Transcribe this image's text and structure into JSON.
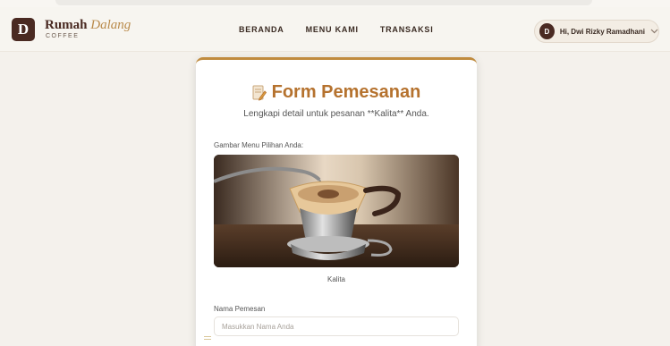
{
  "brand": {
    "logo_letter": "D",
    "name_bold": "Rumah",
    "name_italic": "Dalang",
    "sub": "COFFEE"
  },
  "nav": {
    "links": [
      "BERANDA",
      "MENU KAMI",
      "TRANSAKSI"
    ]
  },
  "user": {
    "avatar_letter": "D",
    "greeting": "Hi, Dwi Rizky Ramadhani"
  },
  "form": {
    "title": "Form Pemesanan",
    "subtitle": "Lengkapi detail untuk pesanan **Kalita** Anda.",
    "image_label": "Gambar Menu Pilihan Anda:",
    "image_caption": "Kalita",
    "name_label": "Nama Pemesan",
    "name_placeholder": "Masukkan Nama Anda",
    "name_value": ""
  },
  "colors": {
    "accent": "#b5722e",
    "brand_dark": "#4a2a22",
    "background": "#f4f1ec"
  }
}
